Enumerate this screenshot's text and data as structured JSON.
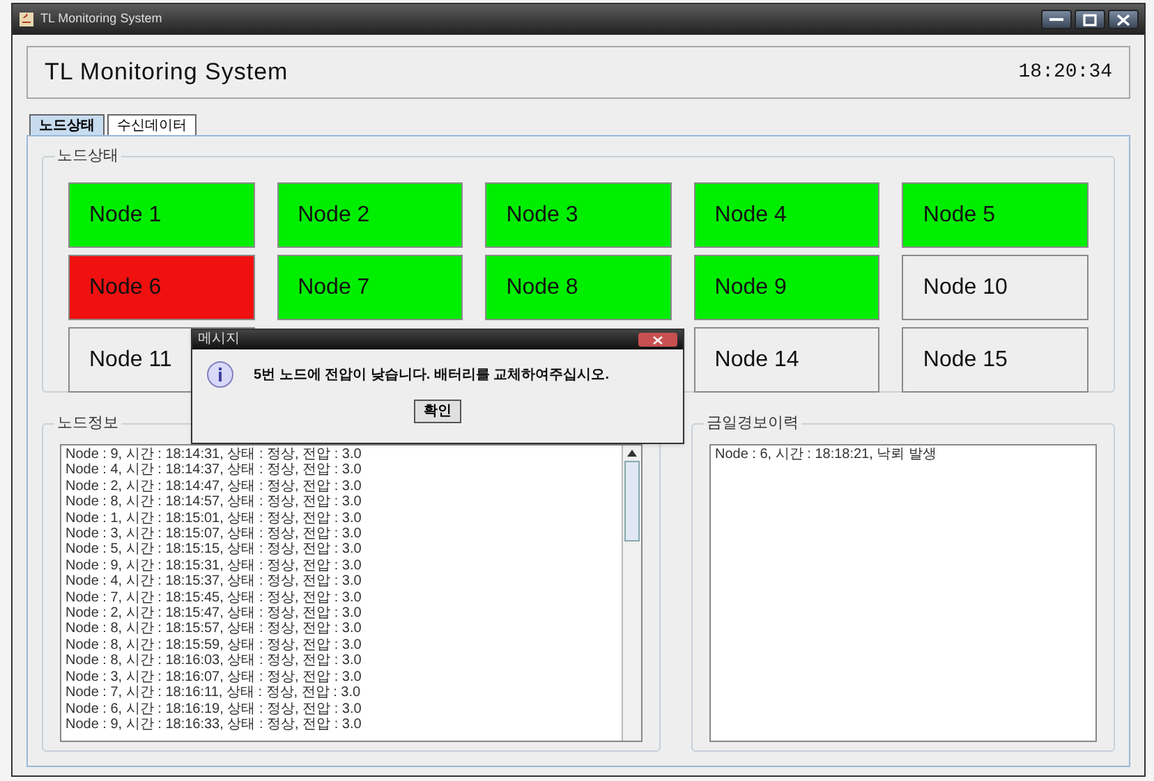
{
  "window": {
    "title": "TL Monitoring System"
  },
  "header": {
    "title": "TL Monitoring System",
    "clock": "18:20:34"
  },
  "tabs": [
    {
      "label": "노드상태",
      "selected": true
    },
    {
      "label": "수신데이터",
      "selected": false
    }
  ],
  "node_status": {
    "title": "노드상태",
    "rows": [
      [
        {
          "label": "Node 1",
          "color": "#00ee00"
        },
        {
          "label": "Node 2",
          "color": "#00ee00"
        },
        {
          "label": "Node 3",
          "color": "#00ee00"
        },
        {
          "label": "Node 4",
          "color": "#00ee00"
        },
        {
          "label": "Node 5",
          "color": "#00ee00"
        }
      ],
      [
        {
          "label": "Node 6",
          "color": "#f01010"
        },
        {
          "label": "Node 7",
          "color": "#00ee00"
        },
        {
          "label": "Node 8",
          "color": "#00ee00"
        },
        {
          "label": "Node 9",
          "color": "#00ee00"
        },
        {
          "label": "Node 10",
          "color": "#eeeeee"
        }
      ],
      [
        {
          "label": "Node 11",
          "color": "#eeeeee"
        },
        null,
        null,
        {
          "label": "Node 14",
          "color": "#eeeeee"
        },
        {
          "label": "Node 15",
          "color": "#eeeeee"
        }
      ]
    ]
  },
  "node_info": {
    "title": "노드정보",
    "lines": [
      "Node : 9,  시간 : 18:14:31,  상태 : 정상,  전압 : 3.0",
      "Node : 4,  시간 : 18:14:37,  상태 : 정상,  전압 : 3.0",
      "Node : 2,  시간 : 18:14:47,  상태 : 정상,  전압 : 3.0",
      "Node : 8,  시간 : 18:14:57,  상태 : 정상,  전압 : 3.0",
      "Node : 1,  시간 : 18:15:01,  상태 : 정상,  전압 : 3.0",
      "Node : 3,  시간 : 18:15:07,  상태 : 정상,  전압 : 3.0",
      "Node : 5,  시간 : 18:15:15,  상태 : 정상,  전압 : 3.0",
      "Node : 9,  시간 : 18:15:31,  상태 : 정상,  전압 : 3.0",
      "Node : 4,  시간 : 18:15:37,  상태 : 정상,  전압 : 3.0",
      "Node : 7,  시간 : 18:15:45,  상태 : 정상,  전압 : 3.0",
      "Node : 2,  시간 : 18:15:47,  상태 : 정상,  전압 : 3.0",
      "Node : 8,  시간 : 18:15:57,  상태 : 정상,  전압 : 3.0",
      "Node : 8,  시간 : 18:15:59,  상태 : 정상,  전압 : 3.0",
      "Node : 8,  시간 : 18:16:03,  상태 : 정상,  전압 : 3.0",
      "Node : 3,  시간 : 18:16:07,  상태 : 정상,  전압 : 3.0",
      "Node : 7,  시간 : 18:16:11,  상태 : 정상,  전압 : 3.0",
      "Node : 6,  시간 : 18:16:19,  상태 : 정상,  전압 : 3.0",
      "Node : 9,  시간 : 18:16:33,  상태 : 정상,  전압 : 3.0"
    ]
  },
  "alarm_history": {
    "title": "금일경보이력",
    "lines": [
      "Node : 6,  시간 : 18:18:21,  낙뢰 발생"
    ]
  },
  "dialog": {
    "title": "메시지",
    "message": "5번 노드에 전압이 낮습니다. 배터리를 교체하여주십시오.",
    "button": "확인"
  }
}
